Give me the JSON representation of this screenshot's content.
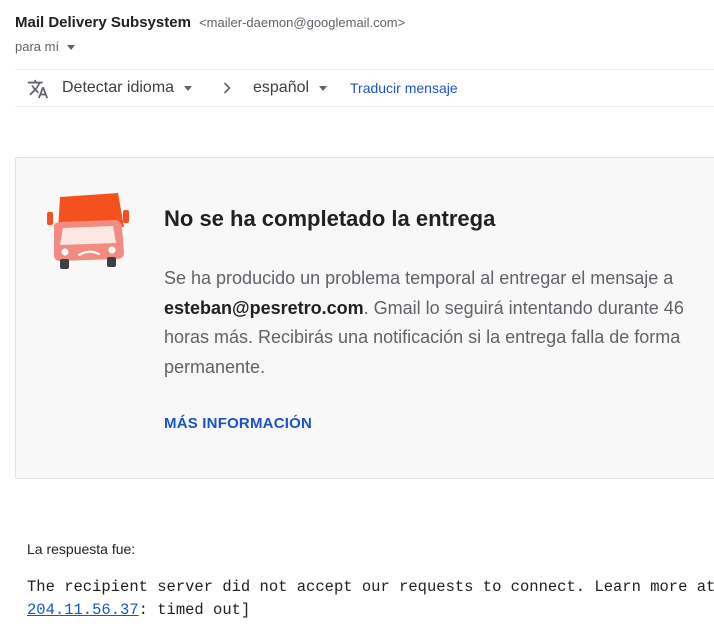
{
  "header": {
    "sender_name": "Mail Delivery Subsystem",
    "sender_email": "<mailer-daemon@googlemail.com>",
    "recipient_label": "para mí"
  },
  "translate_bar": {
    "icon": "translate-icon",
    "source_language": "Detectar idioma",
    "target_language": "español",
    "translate_link": "Traducir mensaje"
  },
  "card": {
    "icon": "delivery-truck-icon",
    "title": "No se ha completado la entrega",
    "body_before": "Se ha producido un problema temporal al entregar el mensaje a ",
    "recipient_email": "esteban@pesretro.com",
    "body_after": ". Gmail lo seguirá intentando durante 46 horas más. Recibirás una notificación si la entrega falla de forma permanente.",
    "link": "MÁS INFORMACIÓN"
  },
  "response": {
    "label": "La respuesta fue:",
    "line1": "The recipient server did not accept our requests to connect. Learn more at",
    "ip": "204.11.56.37",
    "line2_rest": ": timed out]"
  },
  "colors": {
    "link_blue": "#1a55c8",
    "truck_orange": "#f4511e",
    "truck_salmon": "#f28b82",
    "card_background": "#f8f8f8",
    "secondary_text": "#5f6368"
  }
}
